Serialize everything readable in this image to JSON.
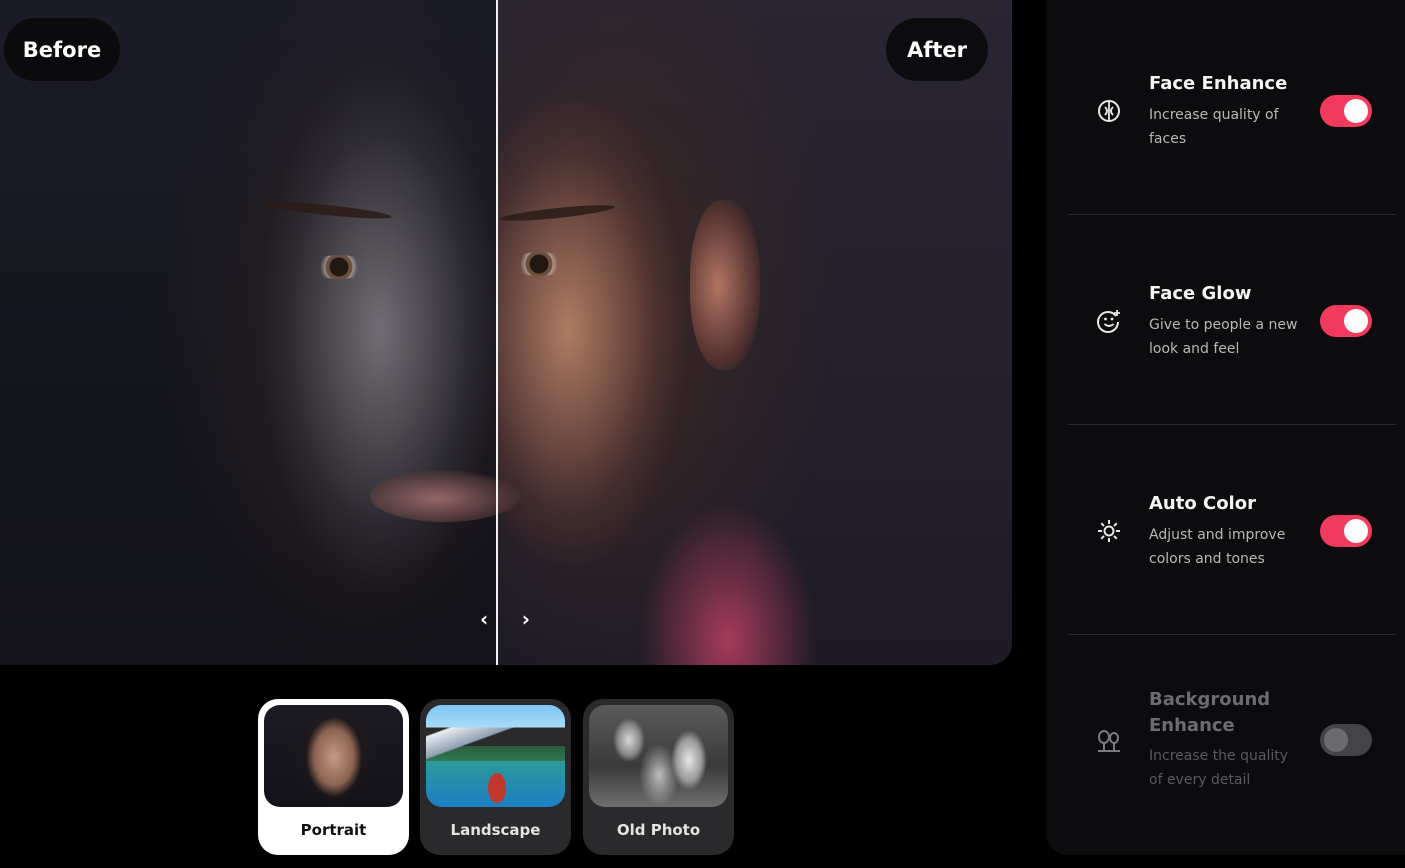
{
  "viewer": {
    "before_label": "Before",
    "after_label": "After"
  },
  "presets": [
    {
      "label": "Portrait",
      "selected": true
    },
    {
      "label": "Landscape",
      "selected": false
    },
    {
      "label": "Old Photo",
      "selected": false
    }
  ],
  "settings": [
    {
      "title": "Face Enhance",
      "description": "Increase quality of faces",
      "icon": "face-enhance-icon",
      "enabled": true
    },
    {
      "title": "Face Glow",
      "description": "Give to people a new look and feel",
      "icon": "face-glow-icon",
      "enabled": true
    },
    {
      "title": "Auto Color",
      "description": "Adjust and improve colors and tones",
      "icon": "sun-icon",
      "enabled": true
    },
    {
      "title": "Background Enhance",
      "description": "Increase the quality of every detail",
      "icon": "trees-icon",
      "enabled": false
    }
  ],
  "colors": {
    "accent": "#f23a5e",
    "panel_bg": "#0c0c0e",
    "toggle_off": "#444447"
  }
}
